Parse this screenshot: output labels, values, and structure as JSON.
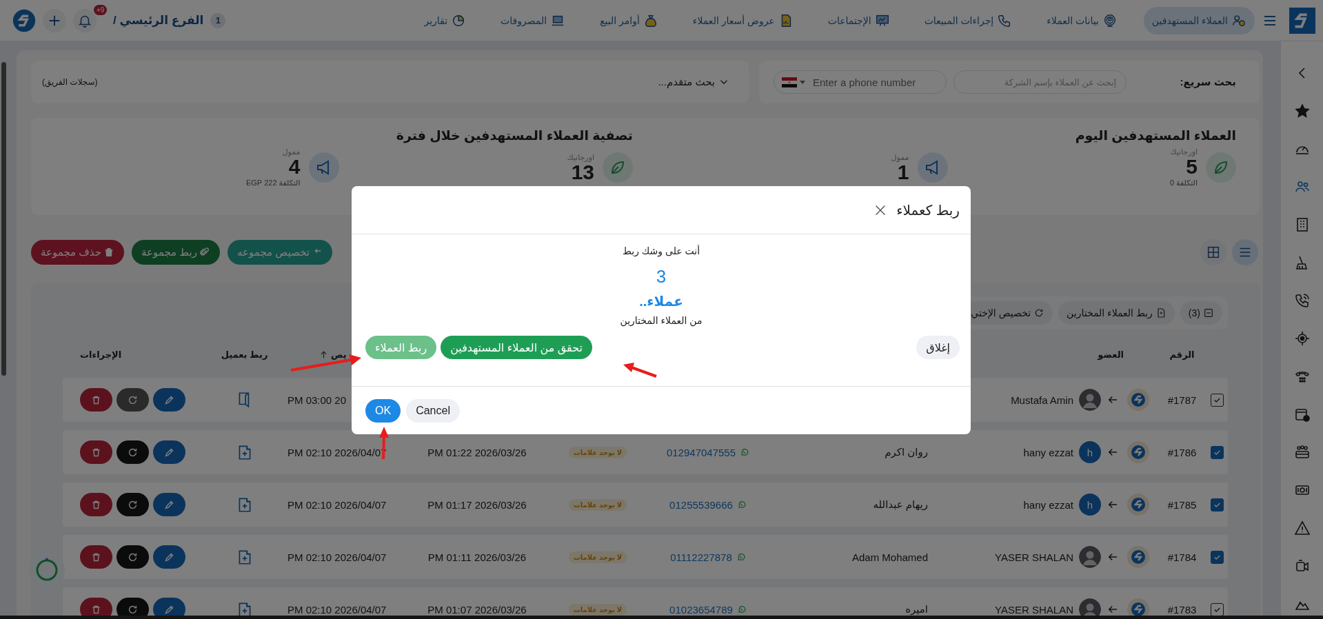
{
  "top_nav": {
    "items": [
      {
        "label": "العملاء المستهدفين",
        "selected": true
      },
      {
        "label": "بيانات العملاء",
        "selected": false
      },
      {
        "label": "إجراءات المبيعات",
        "selected": false
      },
      {
        "label": "الإجتماعات",
        "selected": false
      },
      {
        "label": "عروض أسعار العملاء",
        "selected": false
      },
      {
        "label": "أوامر البيع",
        "selected": false
      },
      {
        "label": "المصروفات",
        "selected": false
      },
      {
        "label": "تقارير",
        "selected": false
      }
    ],
    "branch_count": "1",
    "branch": "الفرع الرئيسي /",
    "notifications_badge": "+9"
  },
  "sidebar": {
    "items": [
      {
        "selected": false
      },
      {
        "selected": false
      },
      {
        "selected": false
      },
      {
        "selected": true
      },
      {
        "selected": false
      },
      {
        "selected": false
      },
      {
        "selected": false
      },
      {
        "selected": false
      },
      {
        "selected": false
      },
      {
        "selected": false
      },
      {
        "selected": false
      },
      {
        "selected": false
      },
      {
        "selected": false
      },
      {
        "selected": false
      },
      {
        "selected": false
      }
    ]
  },
  "filters": {
    "label": "بحث سريع:",
    "company_search": {
      "placeholder": "إبحث عن العملاء بإسم الشركة"
    },
    "phone_search": {
      "placeholder": "Enter a phone number"
    },
    "advanced": "بحث متقدم...",
    "team_records": "(سجلات الفريق)"
  },
  "stats": [
    {
      "title": "العملاء المستهدفين اليوم",
      "metrics": [
        {
          "kind": "organic",
          "label": "اورجانيك",
          "value": "5",
          "cost": "التكلفة 0"
        },
        {
          "kind": "paid",
          "label": "ممول",
          "value": "1"
        }
      ]
    },
    {
      "title": "تصفية العملاء المستهدفين خلال فترة",
      "metrics": [
        {
          "kind": "organic",
          "label": "اورجانيك",
          "value": "13"
        },
        {
          "kind": "paid",
          "label": "ممول",
          "value": "4",
          "cost": "التكلفة 222 EGP"
        }
      ]
    }
  ],
  "view_toggle": [
    {
      "kind": "list",
      "selected": true
    },
    {
      "kind": "grid",
      "selected": false
    }
  ],
  "bulk_actions": [
    {
      "kind": "assign",
      "label": "تخصيص مجموعه"
    },
    {
      "kind": "link",
      "label": "ربط مجموعة"
    },
    {
      "kind": "delete",
      "label": "حذف مجموعة"
    }
  ],
  "table": {
    "toolbar": [
      {
        "kind": "selection",
        "label": "(3)"
      },
      {
        "kind": "link",
        "label": "ربط العملاء المختارين"
      },
      {
        "kind": "assign",
        "label": "تخصيص الإختي"
      }
    ],
    "columns": [
      {
        "label": "الرقم",
        "sorted": false
      },
      {
        "label": "العضو",
        "sorted": false
      },
      {
        "label": "يص",
        "sorted": true
      },
      {
        "label": "ربط بعميل",
        "sorted": false
      },
      {
        "label": "الإجراءات",
        "sorted": false
      }
    ],
    "rows": [
      {
        "checked": true,
        "kind": "outline",
        "id": "#1787",
        "member": "Mustafa Amin",
        "avatar": {
          "kind": "photo"
        },
        "date_2": "PM 03:00 20",
        "linked": true,
        "refresh_disabled": true
      },
      {
        "checked": true,
        "kind": "filled",
        "id": "#1786",
        "member": "hany ezzat",
        "avatar": {
          "kind": "letter",
          "letter": "h"
        },
        "client": "روان اكرم",
        "phone": "012947047555",
        "tag": "لا يوجد علامات",
        "date_1": "PM 01:22 2026/03/26",
        "date_2": "PM 02:10 2026/04/07",
        "linked": false,
        "refresh_disabled": false
      },
      {
        "checked": true,
        "kind": "filled",
        "id": "#1785",
        "member": "hany ezzat",
        "avatar": {
          "kind": "letter",
          "letter": "h"
        },
        "client": "ريهام عبدالله",
        "phone": "01255539666",
        "tag": "لا يوجد علامات",
        "date_1": "PM 01:17 2026/03/26",
        "date_2": "PM 02:10 2026/04/07",
        "linked": false,
        "refresh_disabled": false
      },
      {
        "checked": true,
        "kind": "filled",
        "id": "#1784",
        "member": "YASER SHALAN",
        "avatar": {
          "kind": "photo"
        },
        "client": "Adam Mohamed",
        "phone": "01112227878",
        "tag": "لا يوجد علامات",
        "date_1": "PM 01:11 2026/03/26",
        "date_2": "PM 02:10 2026/04/07",
        "linked": false,
        "refresh_disabled": false
      },
      {
        "checked": true,
        "kind": "outline",
        "id": "#1783",
        "member": "YASER SHALAN",
        "avatar": {
          "kind": "photo"
        },
        "client": "اميره",
        "phone": "01023654789",
        "tag": "لا يوجد علامات",
        "date_1": "PM 01:07 2026/03/26",
        "date_2": "PM 02:10 2026/04/07",
        "linked": false,
        "refresh_disabled": false
      }
    ]
  },
  "modal": {
    "title": "ربط كعملاء",
    "message": "أنت على وشك ربط",
    "count": "3",
    "unit": "عملاء..",
    "note": "من العملاء المختارين",
    "actions": [
      {
        "kind": "close",
        "label": "إغلاق",
        "disabled": false
      },
      {
        "kind": "verify",
        "label": "تحقق من العملاء المستهدفين",
        "disabled": false
      },
      {
        "kind": "link",
        "label": "ربط العملاء",
        "disabled": true
      }
    ],
    "footer": [
      {
        "kind": "secondary",
        "label": "Cancel"
      },
      {
        "kind": "primary",
        "label": "OK"
      }
    ]
  }
}
